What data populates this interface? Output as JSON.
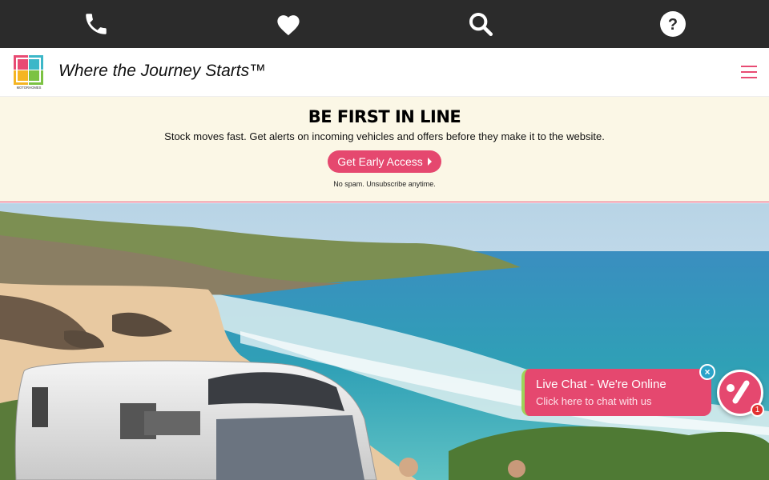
{
  "topbar": {
    "icons": [
      "phone-icon",
      "heart-icon",
      "search-icon",
      "help-icon"
    ],
    "help_glyph": "?"
  },
  "header": {
    "logo_text": "MOTORHOMES",
    "tagline": "Where the Journey Starts™",
    "menu_icon": "hamburger-menu-icon"
  },
  "promo": {
    "title": "BE FIRST IN LINE",
    "subtitle": "Stock moves fast. Get alerts on incoming vehicles and offers before they make it to the website.",
    "cta_label": "Get Early Access",
    "fine_print": "No spam. Unsubscribe anytime."
  },
  "chat": {
    "title": "Live Chat - We're Online",
    "subtitle": "Click here to chat with us",
    "close_glyph": "×",
    "badge_count": "1"
  },
  "colors": {
    "topbar": "#2b2b2b",
    "accent": "#e5486f",
    "promo_bg": "#fbf7e6",
    "chat_close": "#2aa3c9",
    "chat_stripe": "#9ed35a"
  }
}
